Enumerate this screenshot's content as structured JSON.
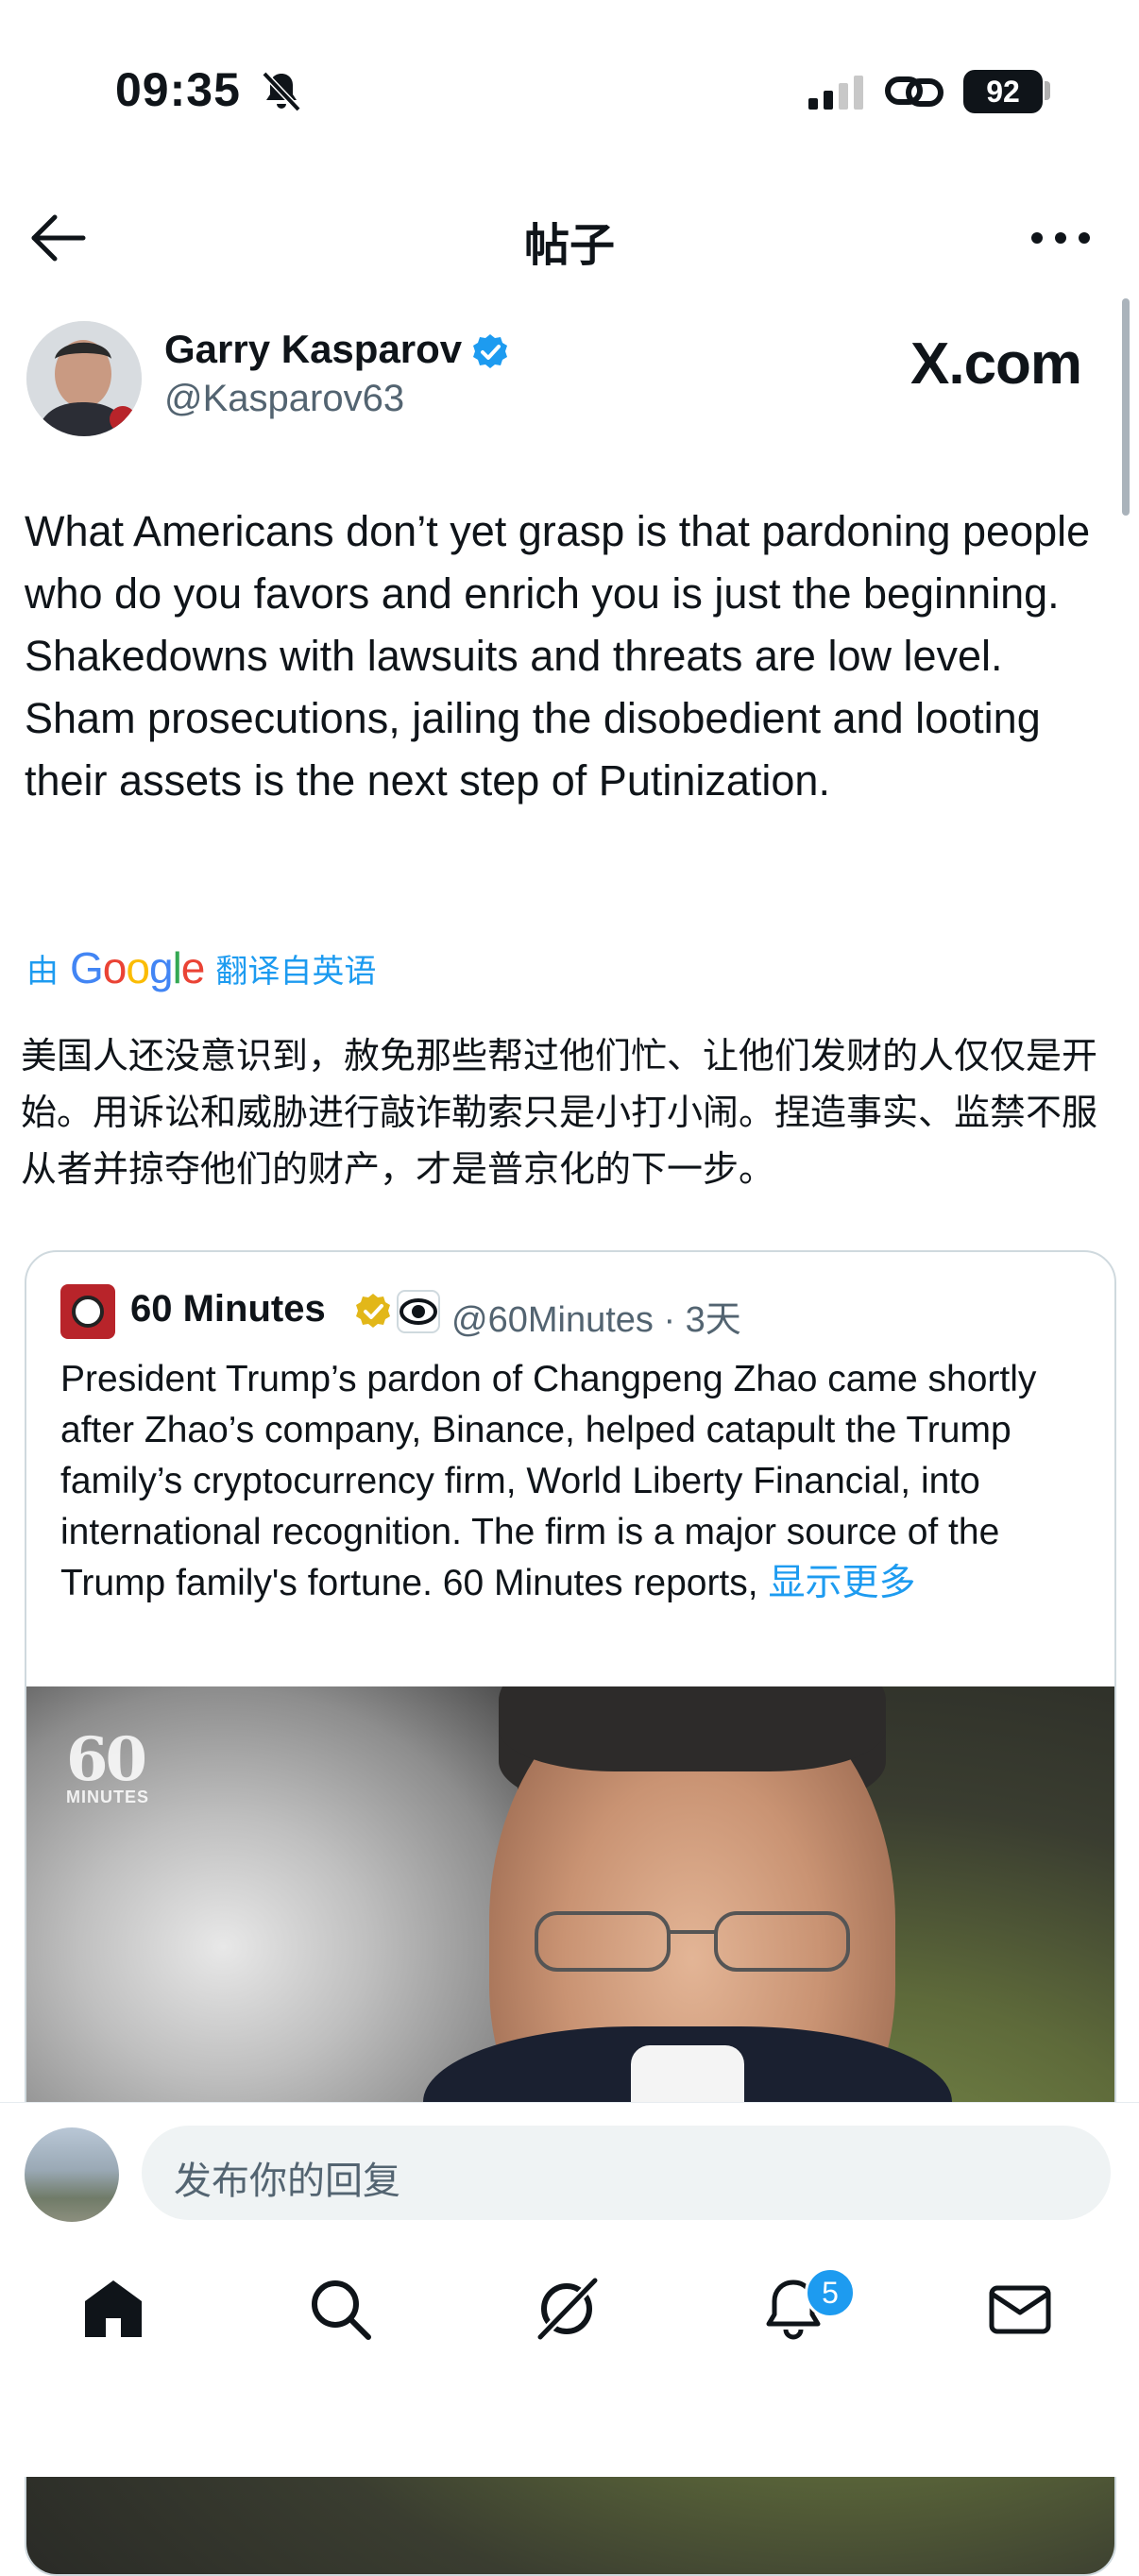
{
  "status_bar": {
    "time": "09:35",
    "battery": "92"
  },
  "header": {
    "title": "帖子"
  },
  "post": {
    "author_name": "Garry Kasparov",
    "author_handle": "@Kasparov63",
    "watermark": "X.com",
    "text": "What Americans don’t yet grasp is that pardoning people who do you favors and enrich you is just the beginning. Shakedowns with lawsuits and threats are low level. Sham prosecutions, jailing the disobedient and looting their assets is the next step of Putinization.",
    "translate_prefix": "由",
    "translate_brand": "Google",
    "translate_suffix": "翻译自英语",
    "translated_text": "美国人还没意识到，赦免那些帮过他们忙、让他们发财的人仅仅是开始。用诉讼和威胁进行敲诈勒索只是小打小闹。捏造事实、监禁不服从者并掠夺他们的财产，才是普京化的下一步。"
  },
  "quote": {
    "name": "60 Minutes",
    "handle": "@60Minutes · 3天",
    "text": "President Trump’s pardon of Changpeng Zhao came shortly after Zhao’s company, Binance, helped catapult the Trump family’s cryptocurrency firm, World Liberty Financial, into international recognition. The firm is a major source of the Trump family's fortune. 60 Minutes reports,",
    "show_more": "显示更多",
    "image_logo": "60",
    "image_logo_sub": "MINUTES"
  },
  "reply": {
    "placeholder": "发布你的回复"
  },
  "nav": {
    "notifications_badge": "5"
  },
  "colors": {
    "accent": "#1d9bf0",
    "text": "#0f1419",
    "secondary": "#536471"
  }
}
